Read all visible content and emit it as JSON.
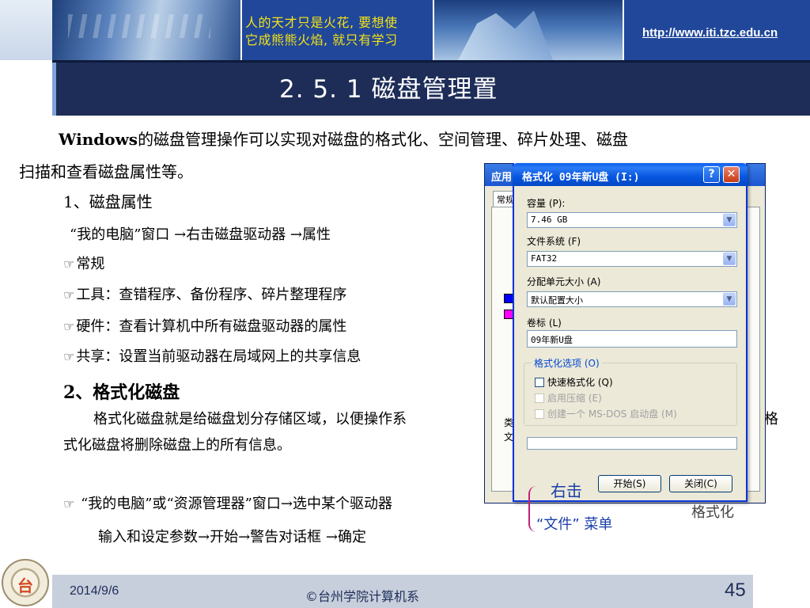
{
  "header": {
    "motto_line1": "人的天才只是火花, 要想使",
    "motto_line2": "它成熊熊火焰, 就只有学习",
    "url": "http://www.iti.tzc.edu.cn"
  },
  "title": "2. 5. 1  磁盘管理置",
  "content": {
    "intro_bold": "Windows",
    "intro_rest": "的磁盘管理操作可以实现对磁盘的格式化、空间管理、碎片处理、磁盘",
    "intro_line2": "扫描和查看磁盘属性等。",
    "section1": "1、磁盘属性",
    "section1_path": "“我的电脑”窗口 →右击磁盘驱动器 →属性",
    "bullets": [
      "常规",
      "工具：查错程序、备份程序、碎片整理程序",
      "硬件：查看计算机中所有磁盘驱动器的属性",
      "共享：设置当前驱动器在局域网上的共享信息"
    ],
    "section2": "2、格式化磁盘",
    "section2_text": "格式化磁盘就是给磁盘划分存储区域，以便操作系",
    "section2_text_end": "格",
    "section2_text2": "式化磁盘将删除磁盘上的所有信息。",
    "op_line1": "“我的电脑”或“资源管理器”窗口→选中某个驱动器",
    "op_line1_tail": "格式化",
    "op_line2": "输入和设定参数→开始→警告对话框 →确定",
    "annotation_right": "右击",
    "annotation_file": "“文件” 菜单"
  },
  "background_dialog": {
    "title": "应用",
    "tab": "常规",
    "side_chars": [
      "类",
      "文"
    ]
  },
  "format_dialog": {
    "title": "格式化 09年新U盘 (I:)",
    "help_label": "?",
    "close_label": "✕",
    "capacity_label": "容量 (P):",
    "capacity_value": "7.46 GB",
    "fs_label": "文件系统 (F)",
    "fs_value": "FAT32",
    "alloc_label": "分配单元大小 (A)",
    "alloc_value": "默认配置大小",
    "volume_label": "卷标 (L)",
    "volume_value": "09年新U盘",
    "options_title": "格式化选项 (O)",
    "options": [
      {
        "label": "快速格式化 (Q)",
        "enabled": true
      },
      {
        "label": "启用压缩 (E)",
        "enabled": false
      },
      {
        "label": "创建一个 MS-DOS 启动盘 (M)",
        "enabled": false
      }
    ],
    "start_button": "开始(S)",
    "close_button": "关闭(C)"
  },
  "footer": {
    "date": "2014/9/6",
    "org": "©台州学院计算机系",
    "page": "45"
  },
  "colors": {
    "header_blue": "#20479a",
    "title_bar": "#1d2d58",
    "motto_yellow": "#f4e215",
    "annotation_blue": "#1a3fa8",
    "bracket_magenta": "#c0207a",
    "footer_bg": "#c8cfdc"
  }
}
